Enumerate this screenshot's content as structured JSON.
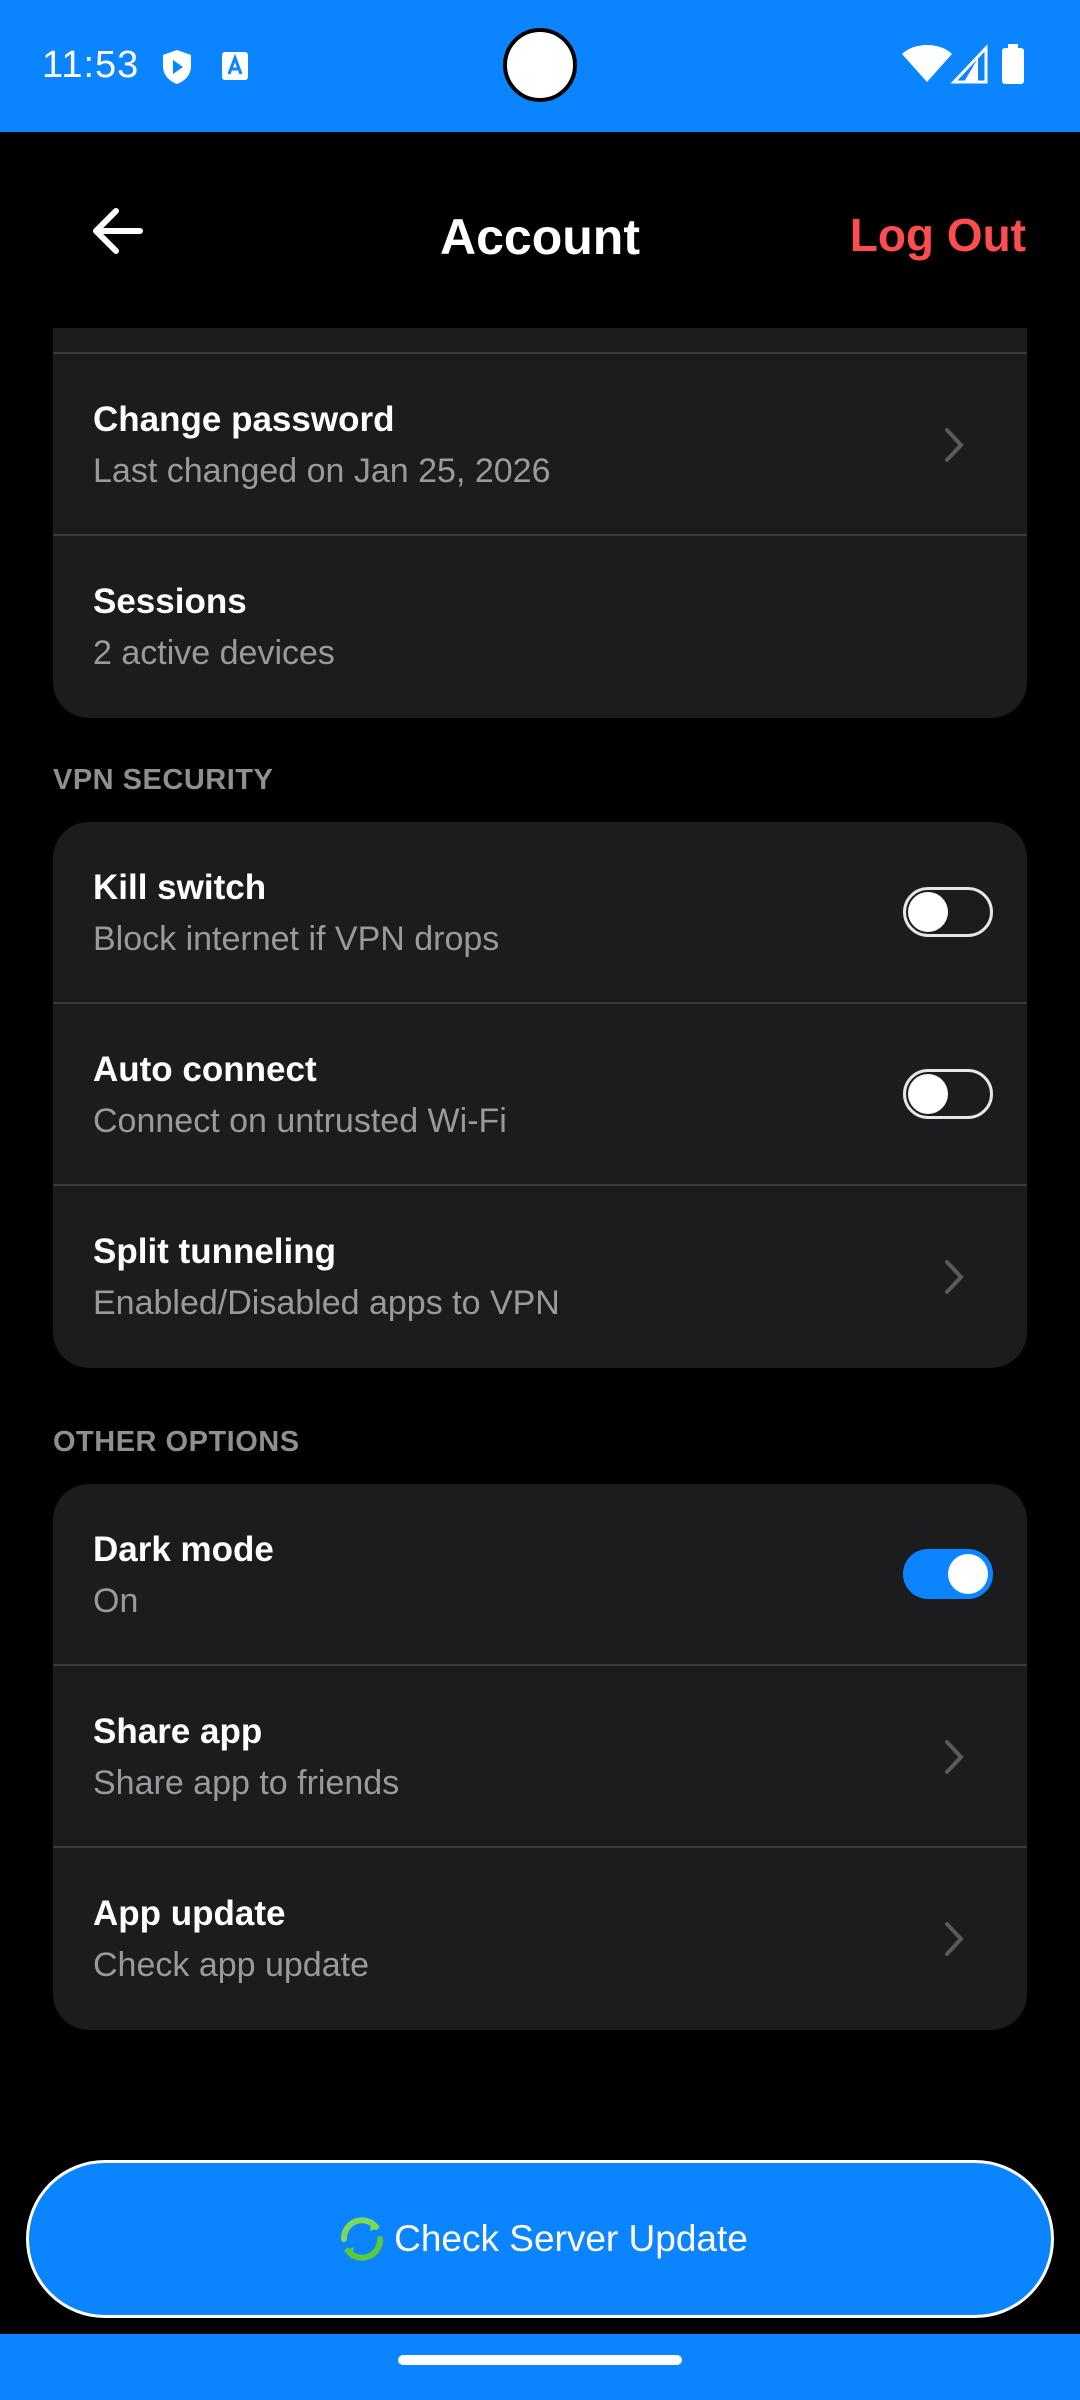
{
  "status_bar": {
    "time": "11:53",
    "icons": [
      "vpn-shield-icon",
      "app-a-icon",
      "wifi-icon",
      "signal-icon",
      "battery-icon"
    ]
  },
  "header": {
    "title": "Account",
    "logout_label": "Log Out"
  },
  "account_section": {
    "rows": [
      {
        "title": "Change password",
        "subtitle": "Last changed on Jan 25, 2026",
        "control": "chevron"
      },
      {
        "title": "Sessions",
        "subtitle": "2 active devices",
        "control": "none"
      }
    ]
  },
  "vpn_security": {
    "label": "VPN SECURITY",
    "rows": [
      {
        "title": "Kill switch",
        "subtitle": "Block internet if VPN drops",
        "control": "toggle",
        "value": false
      },
      {
        "title": "Auto connect",
        "subtitle": "Connect on untrusted Wi-Fi",
        "control": "toggle",
        "value": false
      },
      {
        "title": "Split tunneling",
        "subtitle": "Enabled/Disabled apps to VPN",
        "control": "chevron"
      }
    ]
  },
  "other_options": {
    "label": "OTHER OPTIONS",
    "rows": [
      {
        "title": "Dark mode",
        "subtitle": "On",
        "control": "toggle",
        "value": true
      },
      {
        "title": "Share app",
        "subtitle": "Share app to friends",
        "control": "chevron"
      },
      {
        "title": "App update",
        "subtitle": "Check app update",
        "control": "chevron"
      }
    ]
  },
  "cta": {
    "label": "Check Server Update",
    "icon": "refresh-icon"
  },
  "colors": {
    "accent": "#0a84ff",
    "danger": "#ff4d4f",
    "card": "#1c1c1e",
    "background": "#000000"
  }
}
